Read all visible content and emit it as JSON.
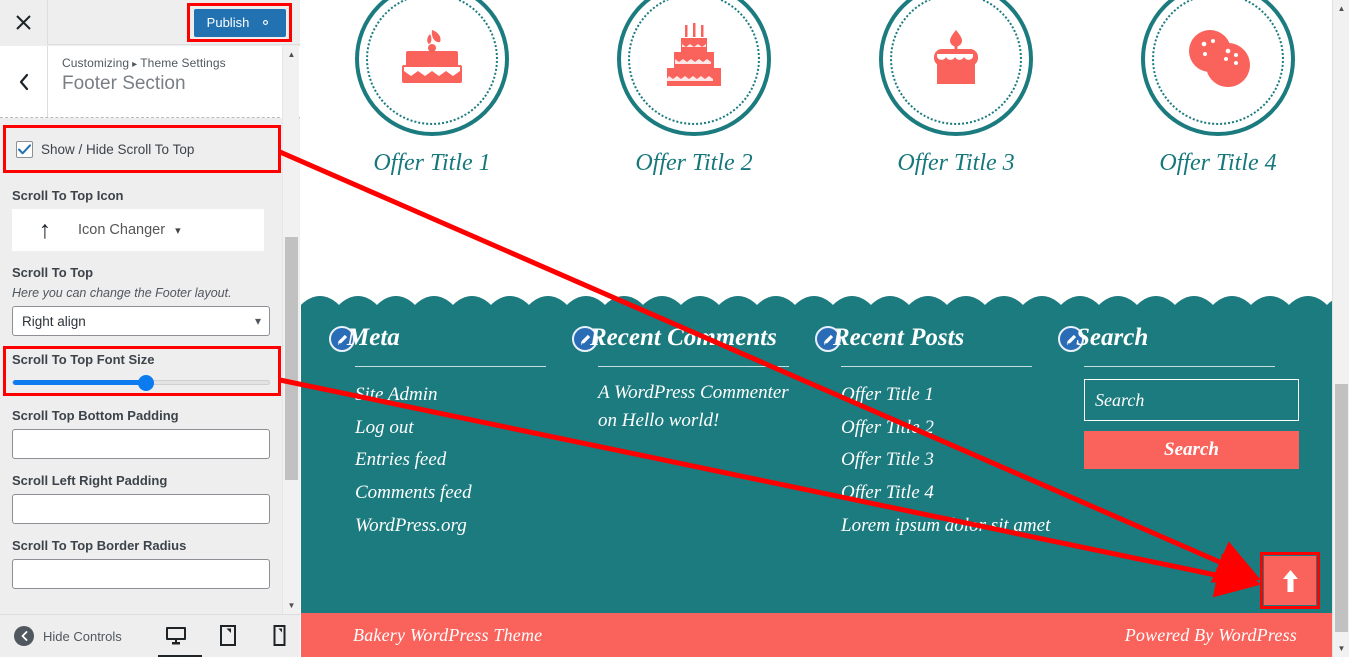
{
  "customizer": {
    "close_icon": "close-icon",
    "publish_label": "Publish",
    "publish_gear_icon": "gear-icon",
    "back_icon": "chevron-left-icon",
    "breadcrumb_root": "Customizing",
    "breadcrumb_sep": "▸",
    "breadcrumb_parent": "Theme Settings",
    "panel_title": "Footer Section",
    "controls": {
      "show_hide_label": "Show / Hide Scroll To Top",
      "show_hide_checked": true,
      "icon_section_label": "Scroll To Top Icon",
      "icon_preview_glyph": "↑",
      "icon_changer_label": "Icon Changer",
      "icon_changer_caret": "⌄",
      "layout_label": "Scroll To Top",
      "layout_description": "Here you can change the Footer layout.",
      "layout_selected": "Right align",
      "layout_caret": "⌄",
      "font_size_label": "Scroll To Top Font Size",
      "font_size_fill_percent": 52,
      "bottom_padding_label": "Scroll Top Bottom Padding",
      "bottom_padding_value": "",
      "left_right_padding_label": "Scroll Left Right Padding",
      "left_right_padding_value": "",
      "border_radius_label": "Scroll To Top Border Radius",
      "border_radius_value": ""
    },
    "footer_bar": {
      "hide_controls_label": "Hide Controls",
      "hide_controls_icon": "chevron-left-circle-icon",
      "devices": [
        {
          "name": "desktop-preview-icon",
          "active": true
        },
        {
          "name": "tablet-preview-icon",
          "active": false
        },
        {
          "name": "mobile-preview-icon",
          "active": false
        }
      ]
    }
  },
  "preview": {
    "offers": [
      {
        "title": "Offer Title 1",
        "icon": "layer-cake-icon"
      },
      {
        "title": "Offer Title 2",
        "icon": "tiered-cake-icon"
      },
      {
        "title": "Offer Title 3",
        "icon": "candle-cake-icon"
      },
      {
        "title": "Offer Title 4",
        "icon": "cookies-icon"
      }
    ],
    "widgets": [
      {
        "title": "Meta",
        "edit_icon": "edit-pencil-icon",
        "type": "list",
        "items": [
          "Site Admin",
          "Log out",
          "Entries feed",
          "Comments feed",
          "WordPress.org"
        ]
      },
      {
        "title": "Recent Comments",
        "edit_icon": "edit-pencil-icon",
        "type": "text",
        "text": "A WordPress Commenter on Hello world!"
      },
      {
        "title": "Recent Posts",
        "edit_icon": "edit-pencil-icon",
        "type": "list",
        "items": [
          "Offer Title 1",
          "Offer Title 2",
          "Offer Title 3",
          "Offer Title 4",
          "Lorem ipsum dolor sit amet"
        ]
      },
      {
        "title": "Search",
        "edit_icon": "edit-pencil-icon",
        "type": "search",
        "search_placeholder": "Search",
        "search_button_label": "Search"
      }
    ],
    "scroll_to_top": {
      "icon": "arrow-up-icon"
    },
    "bottom_bar": {
      "left_text": "Bakery WordPress Theme",
      "right_text": "Powered By WordPress"
    }
  },
  "colors": {
    "teal": "#1b7b7e",
    "coral": "#f9635c",
    "publish_blue": "#2271b1",
    "highlight_red": "#ff0000",
    "slider_blue": "#0d7bf0"
  }
}
